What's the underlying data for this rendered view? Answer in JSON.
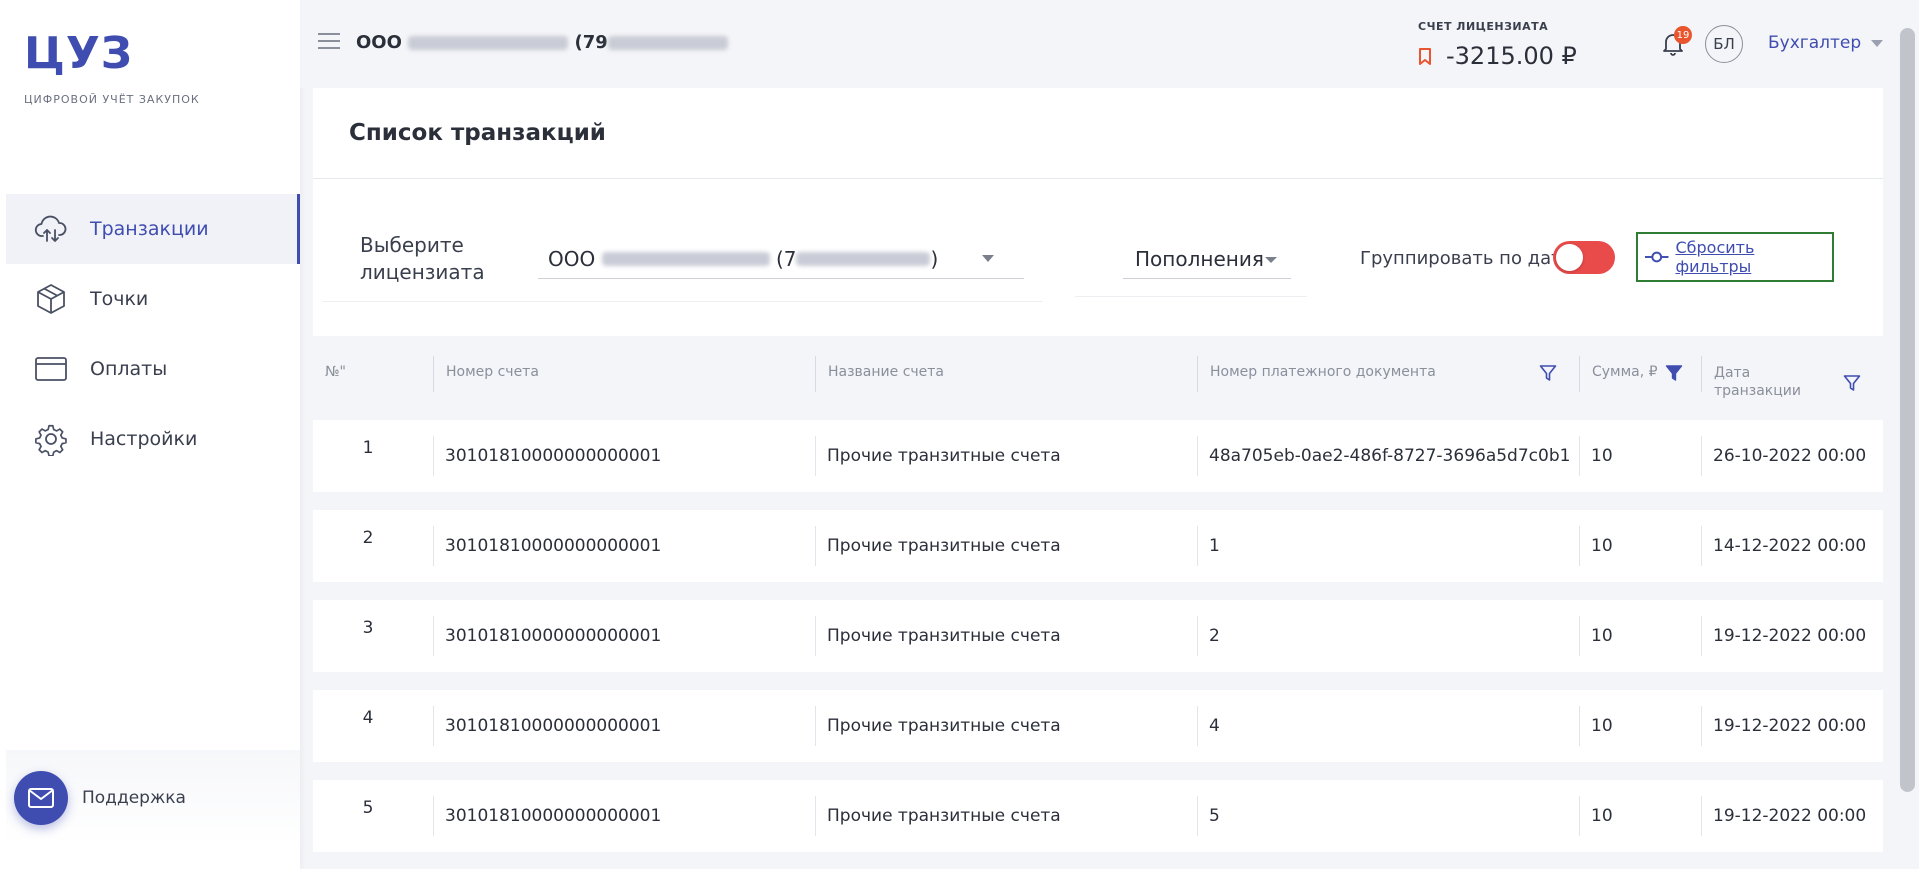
{
  "sidebar": {
    "logo": "ЦУЗ",
    "subtitle": "ЦИФРОВОЙ УЧЁТ ЗАКУПОК",
    "items": [
      {
        "label": "Транзакции",
        "icon": "cloud-transfer-icon",
        "active": true
      },
      {
        "label": "Точки",
        "icon": "cube-icon",
        "active": false
      },
      {
        "label": "Оплаты",
        "icon": "card-icon",
        "active": false
      },
      {
        "label": "Настройки",
        "icon": "gear-icon",
        "active": false
      }
    ],
    "support": "Поддержка"
  },
  "header": {
    "org_prefix": "ООО",
    "org_number_prefix": "(79",
    "account_label": "СЧЕТ ЛИЦЕНЗИАТА",
    "account_value": "-3215.00 ₽",
    "notifications": "19",
    "avatar": "БЛ",
    "role": "Бухгалтер"
  },
  "card": {
    "title": "Список транзакций",
    "licensee_label_1": "Выберите",
    "licensee_label_2": "лицензиата",
    "licensee_prefix": "ООО",
    "licensee_number_prefix": "(7",
    "licensee_suffix": ")",
    "type": "Пополнения",
    "group_label": "Группировать по дате",
    "reset": "Сбросить фильтры"
  },
  "table": {
    "columns": {
      "n": "№\"",
      "account_number": "Номер счета",
      "account_name": "Название счета",
      "doc_number": "Номер платежного документа",
      "amount": "Сумма, ₽",
      "date_1": "Дата",
      "date_2": "транзакции"
    },
    "rows": [
      {
        "n": "1",
        "account_number": "30101810000000000001",
        "account_name": "Прочие транзитные счета",
        "doc_number": "48a705eb-0ae2-486f-8727-3696a5d7c0b1",
        "amount": "10",
        "date": "26-10-2022 00:00"
      },
      {
        "n": "2",
        "account_number": "30101810000000000001",
        "account_name": "Прочие транзитные счета",
        "doc_number": "1",
        "amount": "10",
        "date": "14-12-2022 00:00"
      },
      {
        "n": "3",
        "account_number": "30101810000000000001",
        "account_name": "Прочие транзитные счета",
        "doc_number": "2",
        "amount": "10",
        "date": "19-12-2022 00:00"
      },
      {
        "n": "4",
        "account_number": "30101810000000000001",
        "account_name": "Прочие транзитные счета",
        "doc_number": "4",
        "amount": "10",
        "date": "19-12-2022 00:00"
      },
      {
        "n": "5",
        "account_number": "30101810000000000001",
        "account_name": "Прочие транзитные счета",
        "doc_number": "5",
        "amount": "10",
        "date": "19-12-2022 00:00"
      }
    ]
  },
  "colors": {
    "accent": "#3f4db0",
    "toggle": "#e94b4b",
    "badge": "#e8552e",
    "highlight_border": "#2e7d32"
  }
}
